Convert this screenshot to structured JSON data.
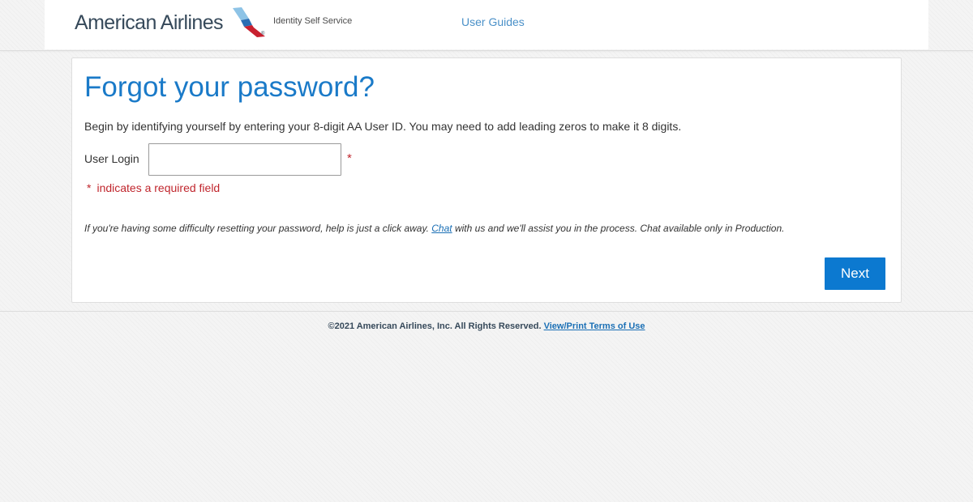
{
  "header": {
    "brand_name": "American Airlines",
    "brand_tm": "®",
    "product_name": "Identity Self Service",
    "nav_link": "User Guides"
  },
  "form": {
    "title": "Forgot your password?",
    "instructions": "Begin by identifying yourself by entering your 8-digit AA User ID. You may need to add leading zeros to make it 8 digits.",
    "login_label": "User Login",
    "login_value": "",
    "required_marker": "*",
    "required_note": "indicates a required field",
    "help_text_before": "If you're having some difficulty resetting your password, help is just a click away.",
    "help_link": "Chat",
    "help_text_after": "with us and we'll assist you in the process. Chat available only in Production.",
    "next_label": "Next"
  },
  "footer": {
    "copyright": "©2021 American Airlines, Inc. All Rights Reserved.",
    "terms_link": "View/Print Terms of Use"
  },
  "colors": {
    "accent_blue": "#1a7ac8",
    "button_blue": "#0c79d0",
    "required_red": "#c0262d",
    "brand_text": "#36495a",
    "logo_red": "#c8202f",
    "logo_light_blue": "#8dc3e6",
    "logo_dark_blue": "#2a6eb3"
  },
  "icons": {
    "logo": "flight-symbol-icon"
  }
}
